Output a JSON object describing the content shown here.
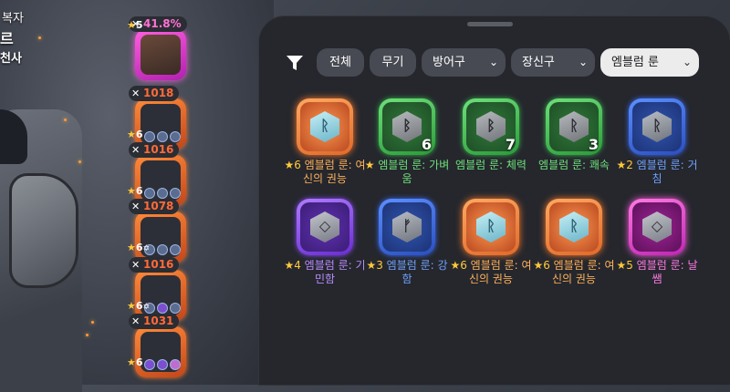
{
  "hero": {
    "line1": "복자",
    "line2": "르",
    "line3": "천사"
  },
  "equipment": [
    {
      "badge": "41.8%",
      "stars": "5",
      "plus": "",
      "color": "pink"
    },
    {
      "badge": "1018",
      "stars": "6",
      "plus": "",
      "color": "orange"
    },
    {
      "badge": "1016",
      "stars": "6",
      "plus": "",
      "color": "orange"
    },
    {
      "badge": "1078",
      "stars": "6",
      "plus": "✡",
      "color": "orange"
    },
    {
      "badge": "1016",
      "stars": "6",
      "plus": "✡",
      "color": "orange"
    },
    {
      "badge": "1031",
      "stars": "6",
      "plus": "",
      "color": "orange"
    }
  ],
  "filters": {
    "chips": [
      {
        "label": "전체"
      },
      {
        "label": "무기"
      },
      {
        "label": "방어구"
      },
      {
        "label": "장신구"
      },
      {
        "label": "엠블럼 룬"
      }
    ]
  },
  "items": [
    {
      "star": "★6",
      "label": "엠블럼 룬: 여신의 권능",
      "count": "",
      "glyph": "ᚱ",
      "color": "orange"
    },
    {
      "star": "★",
      "label": "엠블럼 룬: 가벼움",
      "count": "6",
      "glyph": "ᛒ",
      "color": "green"
    },
    {
      "star": "",
      "label": "엠블럼 룬: 체력",
      "count": "7",
      "glyph": "ᛒ",
      "color": "green"
    },
    {
      "star": "",
      "label": "엠블럼 룬: 쾌속",
      "count": "3",
      "glyph": "ᚱ",
      "color": "green"
    },
    {
      "star": "★2",
      "label": "엠블럼 룬: 거침",
      "count": "",
      "glyph": "ᚱ",
      "color": "blue"
    },
    {
      "star": "★4",
      "label": "엠블럼 룬: 기민함",
      "count": "",
      "glyph": "◇",
      "color": "purple"
    },
    {
      "star": "★3",
      "label": "엠블럼 룬: 강함",
      "count": "",
      "glyph": "ᚠ",
      "color": "blue"
    },
    {
      "star": "★6",
      "label": "엠블럼 룬: 여신의 권능",
      "count": "",
      "glyph": "ᚱ",
      "color": "orange"
    },
    {
      "star": "★6",
      "label": "엠블럼 룬: 여신의 권능",
      "count": "",
      "glyph": "ᚱ",
      "color": "orange"
    },
    {
      "star": "★5",
      "label": "엠블럼 룬: 날쌤",
      "count": "",
      "glyph": "◇",
      "color": "pink"
    }
  ]
}
